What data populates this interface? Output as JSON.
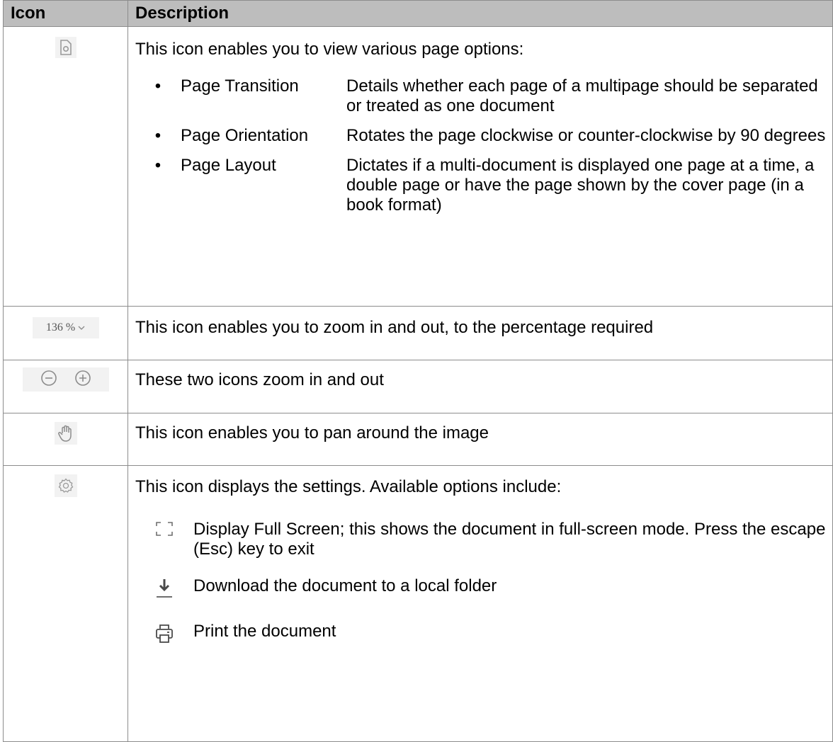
{
  "header": {
    "icon_col": "Icon",
    "desc_col": "Description"
  },
  "rows": {
    "page_options": {
      "intro": "This icon enables you to view various page options:",
      "items": [
        {
          "name": "Page Transition",
          "desc": "Details whether each page of a multipage should be separated or treated as one document"
        },
        {
          "name": "Page Orientation",
          "desc": "Rotates the page clockwise or counter-clockwise by 90 degrees"
        },
        {
          "name": "Page Layout",
          "desc": "Dictates if a multi-document is displayed one page at a time, a double page or have the page shown by the cover page (in a book format)"
        }
      ]
    },
    "zoom_percent": {
      "icon_text": "136 %",
      "desc": "This icon enables you to zoom in and out, to the percentage required"
    },
    "zoom_buttons": {
      "desc": "These two icons zoom in and out"
    },
    "pan": {
      "desc": "This icon enables you to pan around the image"
    },
    "settings": {
      "intro": "This icon displays the settings. Available options include:",
      "items": [
        {
          "icon": "fullscreen-icon",
          "desc": "Display Full Screen; this shows the document in full-screen mode. Press the escape (Esc) key to exit"
        },
        {
          "icon": "download-icon",
          "desc": "Download the document to a local folder"
        },
        {
          "icon": "print-icon",
          "desc": "Print the document"
        }
      ]
    }
  }
}
